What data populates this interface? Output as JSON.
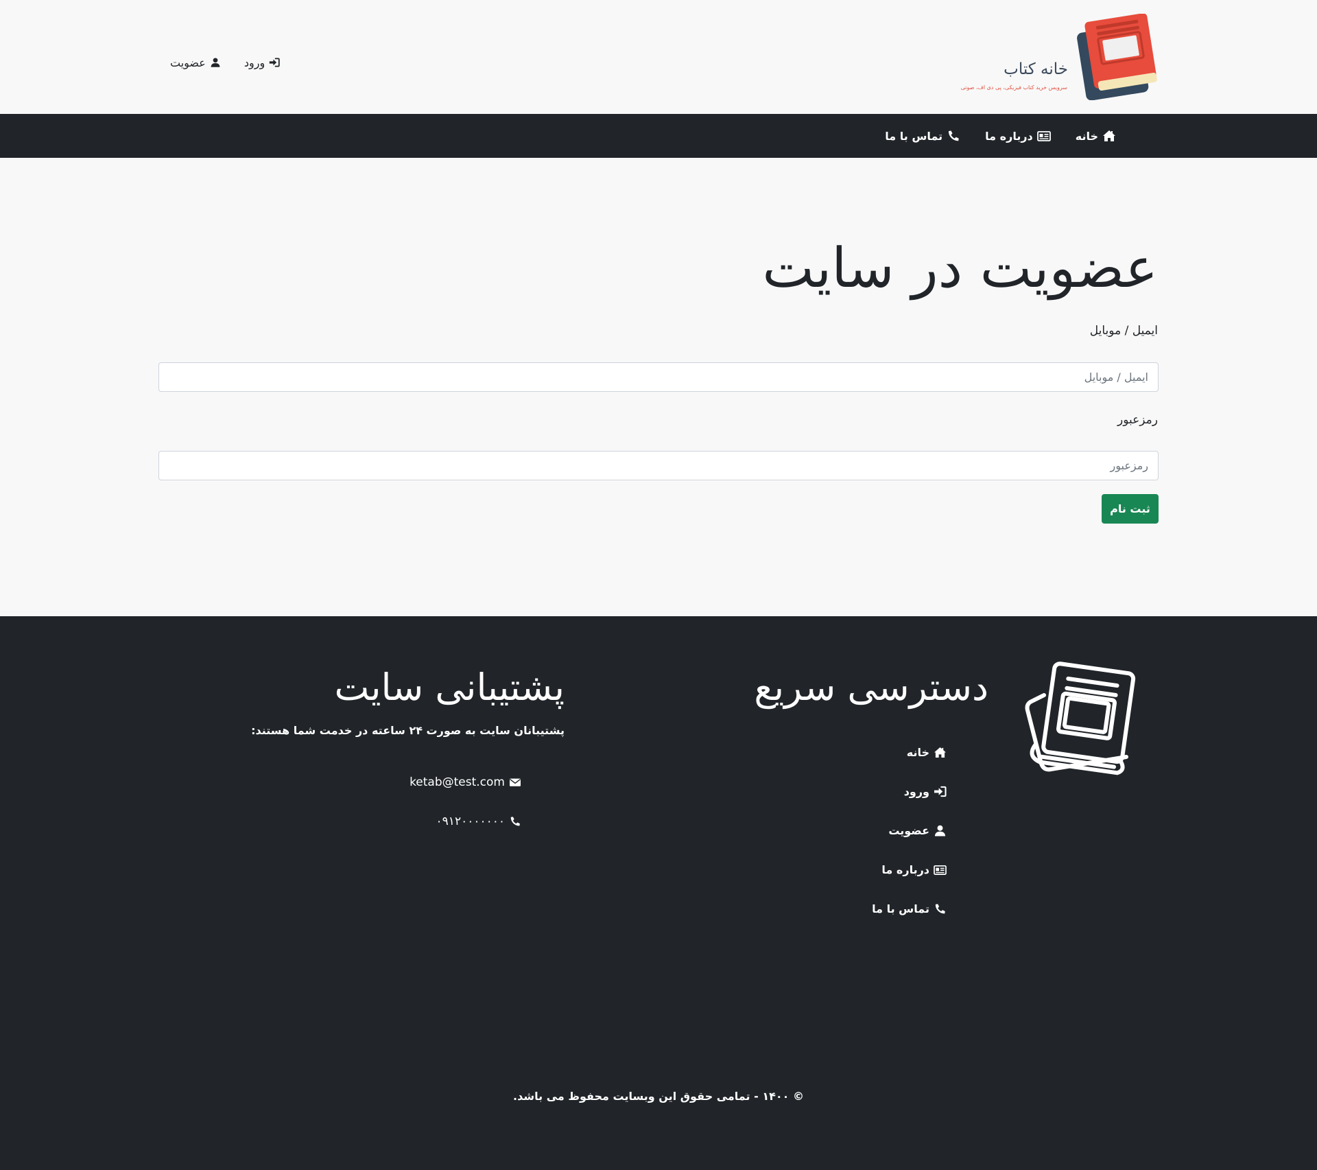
{
  "header": {
    "logo_title": "خانه کتاب",
    "logo_subtitle": "سرویس خرید کتاب فیزیکی، پی دی اف، صوتی",
    "register_link": "عضویت",
    "login_link": "ورود"
  },
  "nav": {
    "items": [
      {
        "label": "خانه",
        "icon": "home-icon"
      },
      {
        "label": "درباره ما",
        "icon": "id-card-icon"
      },
      {
        "label": "تماس با ما",
        "icon": "phone-icon"
      }
    ]
  },
  "form": {
    "title": "عضویت در سایت",
    "email_label": "ایمیل / موبایل",
    "email_placeholder": "ایمیل / موبایل",
    "email_value": "",
    "password_label": "رمزعبور",
    "password_placeholder": "رمزعبور",
    "password_value": "",
    "submit_label": "ثبت نام",
    "submit_color": "#198754"
  },
  "footer": {
    "quick_access_title": "دسترسی سریع",
    "quick_links": [
      {
        "label": "خانه",
        "icon": "home-icon"
      },
      {
        "label": "ورود",
        "icon": "sign-in-icon"
      },
      {
        "label": "عضویت",
        "icon": "user-icon"
      },
      {
        "label": "درباره ما",
        "icon": "id-card-icon"
      },
      {
        "label": "تماس با ما",
        "icon": "phone-icon"
      }
    ],
    "support_title": "پشتیبانی سایت",
    "support_text": "پشتیبانان سایت به صورت ۲۴ ساعته در خدمت شما هستند:",
    "email": "ketab@test.com",
    "phone": "۰۹۱۲۰۰۰۰۰۰۰",
    "copyright": "© ۱۴۰۰ - تمامی حقوق این وبسایت محفوظ می باشد.",
    "background_color": "#212529"
  }
}
